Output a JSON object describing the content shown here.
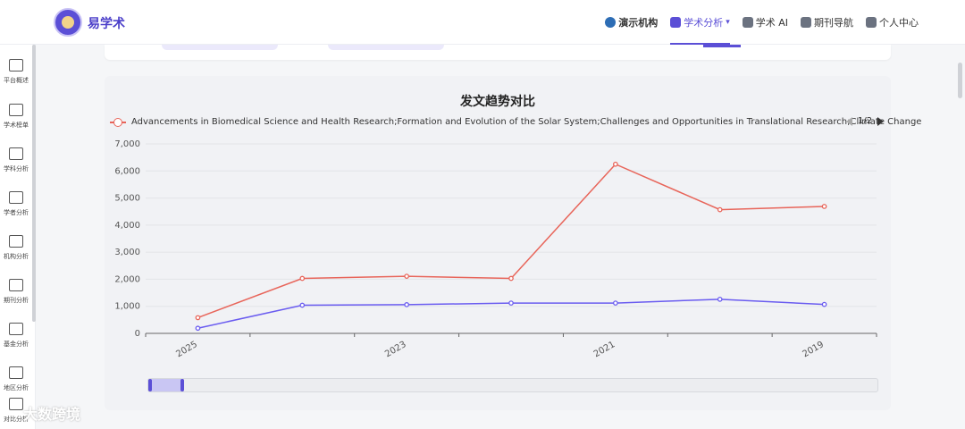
{
  "brand": {
    "name": "易学术"
  },
  "nav": {
    "org": "演示机构",
    "academic_analysis": "学术分析",
    "academic_ai": "学术 AI",
    "journal_nav": "期刊导航",
    "personal_center": "个人中心"
  },
  "sidebar": {
    "items": [
      {
        "label": "平台概述",
        "icon": "home-icon"
      },
      {
        "label": "学术榜单",
        "icon": "list-icon"
      },
      {
        "label": "学科分析",
        "icon": "hierarchy-icon"
      },
      {
        "label": "学者分析",
        "icon": "users-icon"
      },
      {
        "label": "机构分析",
        "icon": "building-icon"
      },
      {
        "label": "期刊分析",
        "icon": "journal-icon"
      },
      {
        "label": "基金分析",
        "icon": "money-icon"
      },
      {
        "label": "地区分析",
        "icon": "location-icon"
      },
      {
        "label": "对比分析",
        "icon": "compare-icon"
      }
    ]
  },
  "panel": {
    "title": "发文趋势对比",
    "legend_text": "Advancements in Biomedical Science and Health Research;Formation and Evolution of the Solar System;Challenges and Opportunities in Translational Research;Climate Change",
    "pager": "1/2"
  },
  "watermark": "大数跨境",
  "colors": {
    "accent": "#5b4fd6",
    "series_red": "#e8655a",
    "series_blue": "#6a5cf0"
  },
  "chart_data": {
    "type": "line",
    "x": [
      "2025",
      "2024",
      "2023",
      "2022",
      "2021",
      "2020",
      "2019"
    ],
    "x_tick_labels": [
      "2025",
      "2023",
      "2021",
      "2019"
    ],
    "ylim": [
      0,
      7000
    ],
    "y_ticks": [
      "0",
      "1,000",
      "2,000",
      "3,000",
      "4,000",
      "5,000",
      "6,000",
      "7,000"
    ],
    "grid": true,
    "legend": "top-left",
    "series": [
      {
        "name": "Advancements in Biomedical Science and Health Research;Formation and Evolution of the Solar System;Challenges and Opportunities in Translational Research;Climate Change",
        "color": "#e8655a",
        "values": [
          580,
          2030,
          2110,
          2030,
          6250,
          4570,
          4690
        ]
      },
      {
        "color": "#6a5cf0",
        "values": [
          190,
          1040,
          1060,
          1120,
          1120,
          1260,
          1070
        ]
      }
    ]
  }
}
